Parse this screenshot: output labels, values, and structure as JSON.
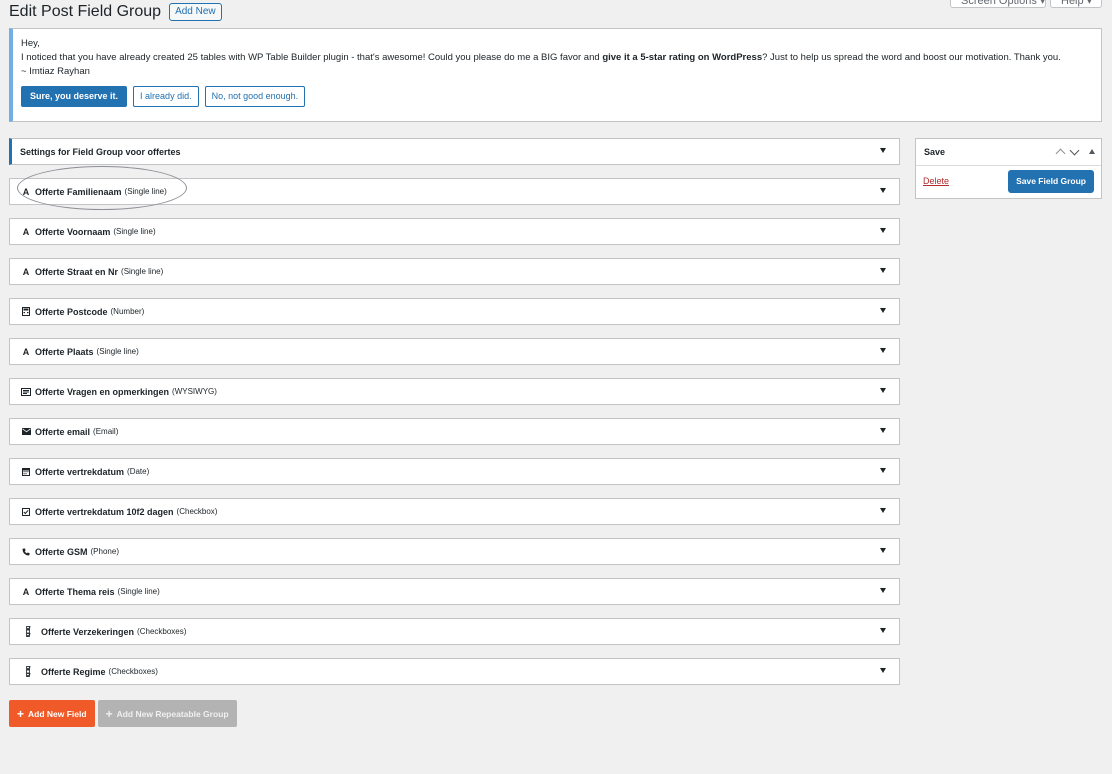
{
  "top_tabs": {
    "screen_options": "Screen Options ▾",
    "help": "Help ▾"
  },
  "page": {
    "title": "Edit Post Field Group",
    "add_new": "Add New"
  },
  "notice": {
    "greeting": "Hey,",
    "message_start": "I noticed that you have already created 25 tables with WP Table Builder plugin - that's awesome! Could you please do me a BIG favor and ",
    "message_bold": "give it a 5-star rating on WordPress",
    "message_end": "? Just to help us spread the word and boost our motivation. Thank you.",
    "signature": "~ Imtiaz Rayhan",
    "buttons": {
      "yes": "Sure, you deserve it.",
      "did": "I already did.",
      "no": "No, not good enough."
    }
  },
  "settings_row": {
    "label": "Settings for Field Group voor offertes"
  },
  "fields": [
    {
      "name": "Offerte Familienaam",
      "type": "(Single line)",
      "icon": "text-a-icon"
    },
    {
      "name": "Offerte Voornaam",
      "type": "(Single line)",
      "icon": "text-a-icon"
    },
    {
      "name": "Offerte Straat en Nr",
      "type": "(Single line)",
      "icon": "text-a-icon"
    },
    {
      "name": "Offerte Postcode",
      "type": "(Number)",
      "icon": "calculator-icon"
    },
    {
      "name": "Offerte Plaats",
      "type": "(Single line)",
      "icon": "text-a-icon"
    },
    {
      "name": "Offerte Vragen en opmerkingen",
      "type": "(WYSIWYG)",
      "icon": "editor-icon"
    },
    {
      "name": "Offerte email",
      "type": "(Email)",
      "icon": "envelope-icon"
    },
    {
      "name": "Offerte vertrekdatum",
      "type": "(Date)",
      "icon": "calendar-icon"
    },
    {
      "name": "Offerte vertrekdatum 10f2 dagen",
      "type": "(Checkbox)",
      "icon": "checkbox-icon"
    },
    {
      "name": "Offerte GSM",
      "type": "(Phone)",
      "icon": "phone-icon"
    },
    {
      "name": "Offerte Thema reis",
      "type": "(Single line)",
      "icon": "text-a-icon"
    },
    {
      "name": "Offerte Verzekeringen",
      "type": "(Checkboxes)",
      "icon": "checkboxes-icon"
    },
    {
      "name": "Offerte Regime",
      "type": "(Checkboxes)",
      "icon": "checkboxes-icon"
    }
  ],
  "actions": {
    "add_field": "Add New Field",
    "add_group": "Add New Repeatable Group"
  },
  "save_box": {
    "title": "Save",
    "delete": "Delete",
    "save": "Save Field Group"
  },
  "colors": {
    "accent": "#2271b1",
    "orange": "#f05a28",
    "delete": "#b32d2e",
    "notice_border": "#72aee6"
  }
}
